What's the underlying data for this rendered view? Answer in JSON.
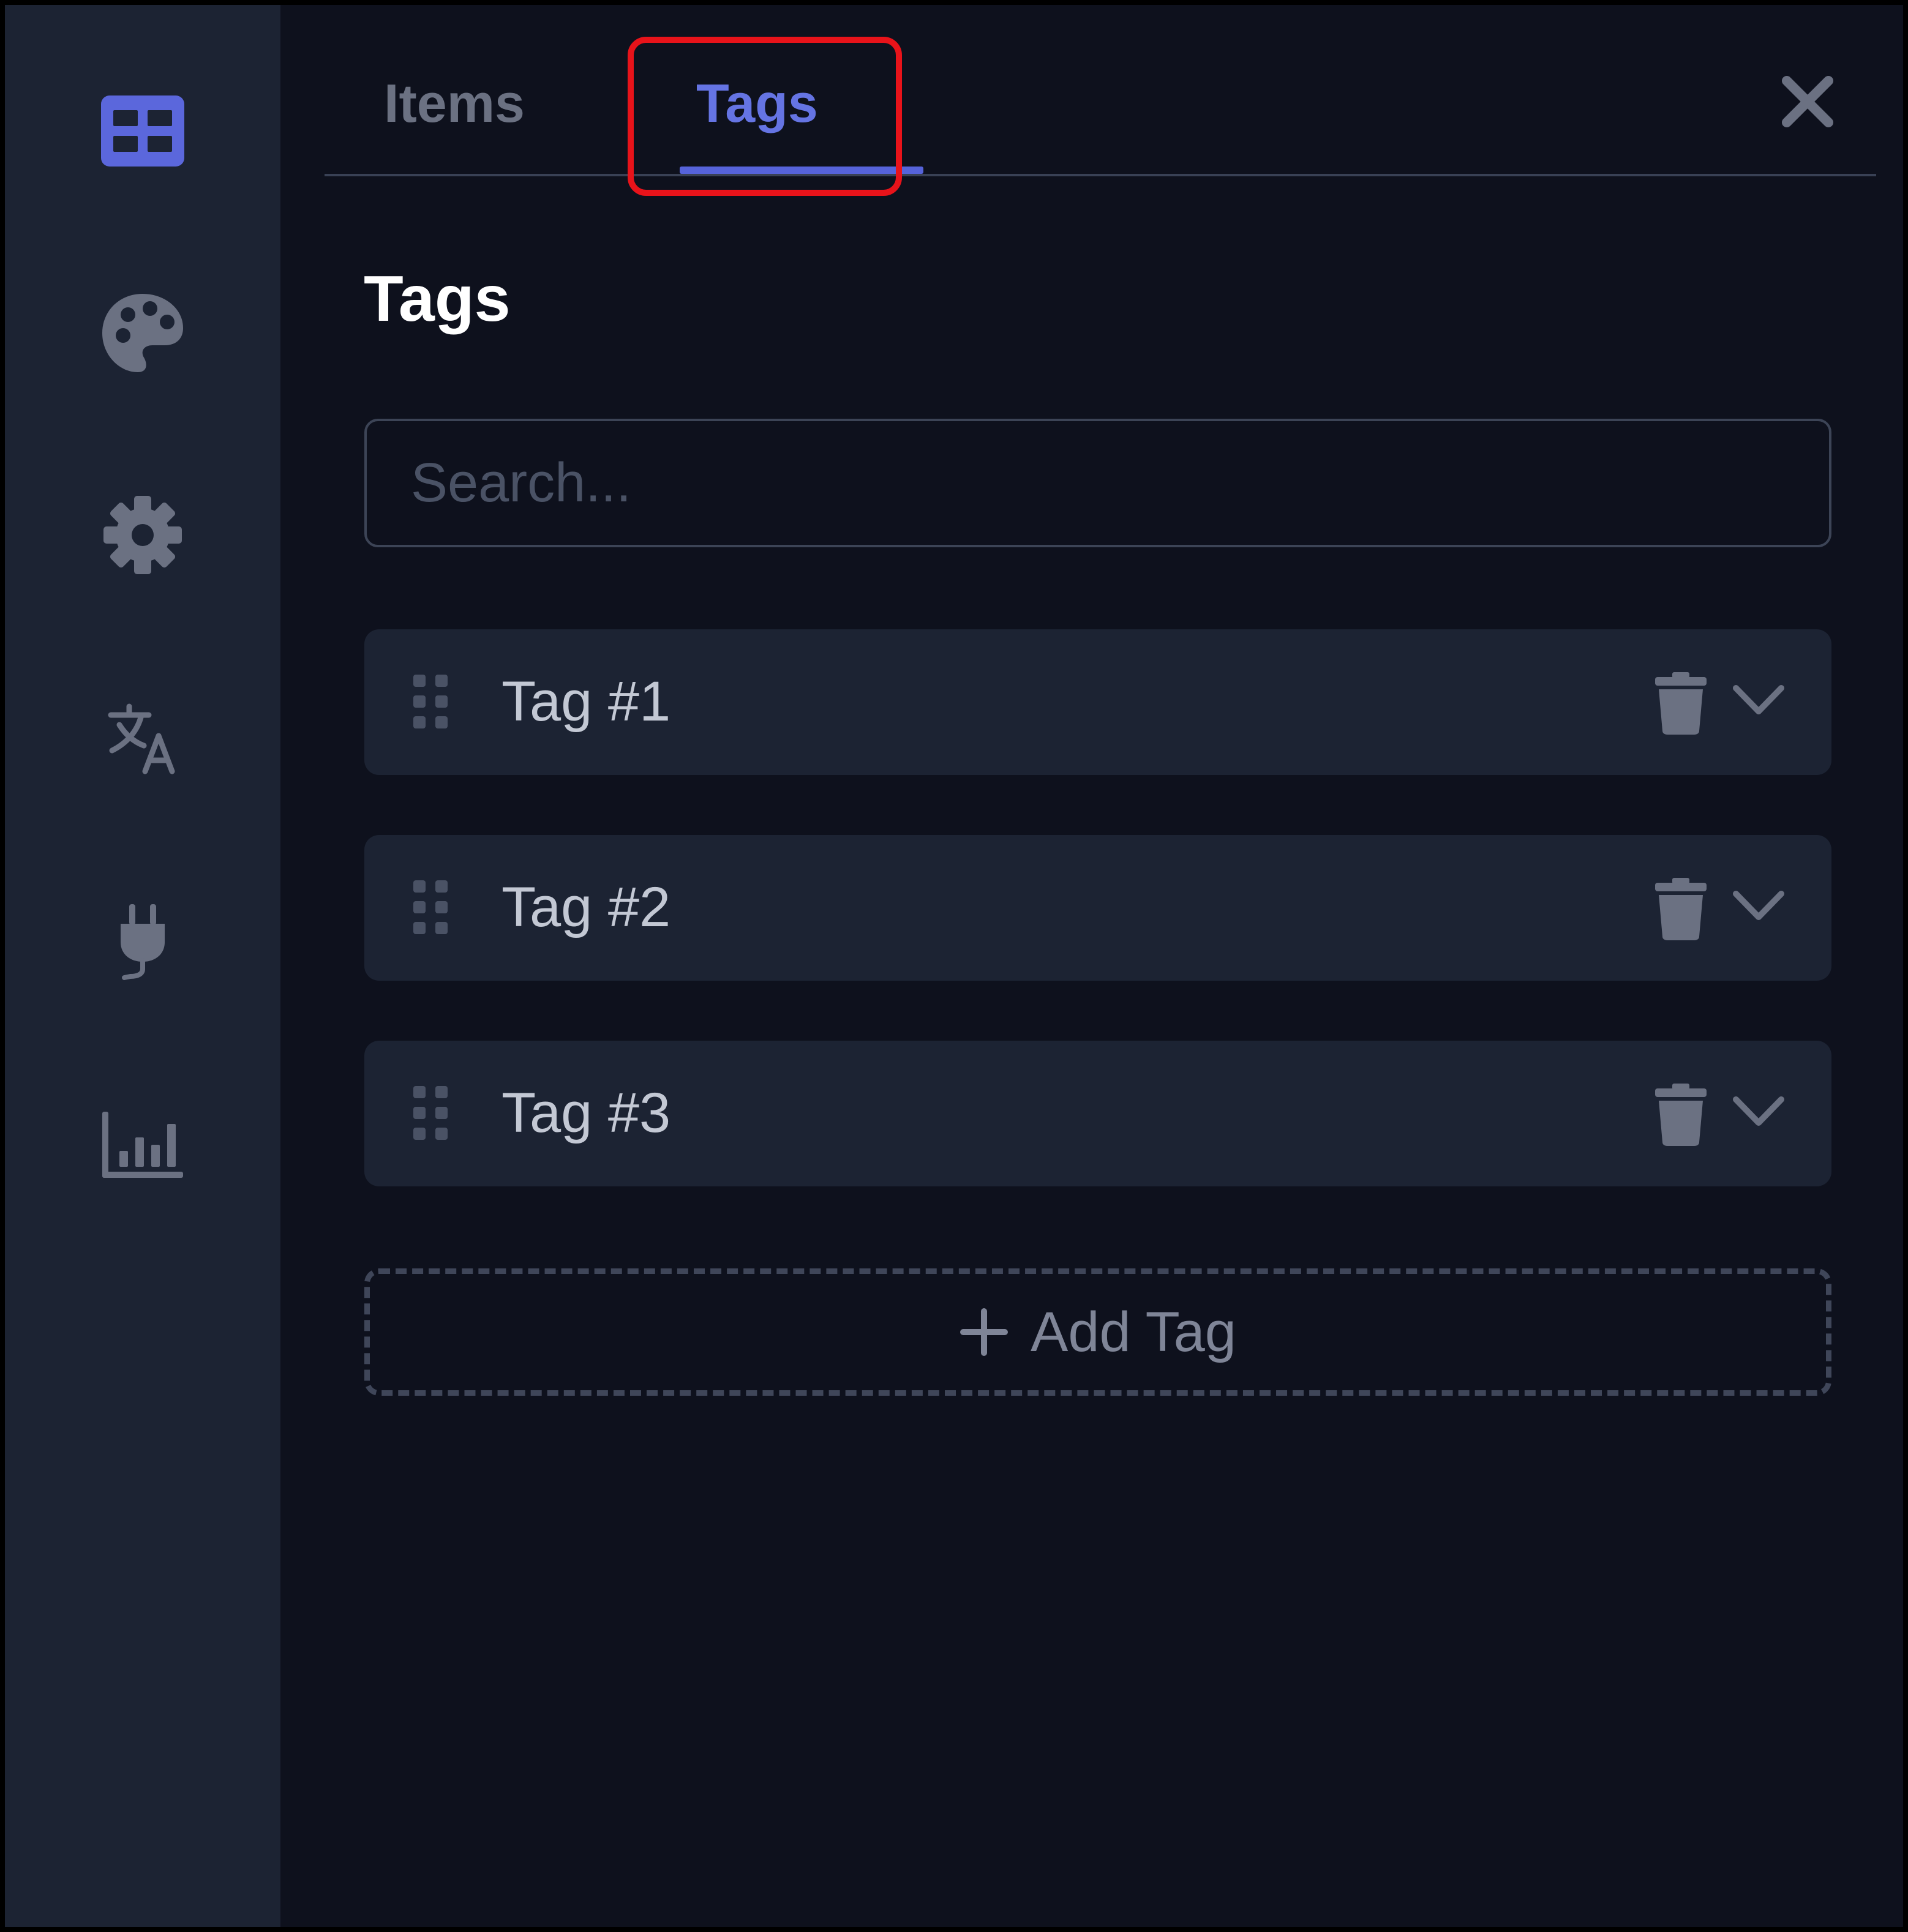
{
  "tabs": [
    {
      "label": "Items",
      "active": false
    },
    {
      "label": "Tags",
      "active": true
    }
  ],
  "section": {
    "title": "Tags"
  },
  "search": {
    "placeholder": "Search...",
    "value": ""
  },
  "tags": [
    {
      "label": "Tag #1"
    },
    {
      "label": "Tag #2"
    },
    {
      "label": "Tag #3"
    }
  ],
  "add_button": {
    "label": "Add Tag",
    "icon": "plus-icon"
  },
  "sidebar": {
    "icons": [
      "grid-icon",
      "palette-icon",
      "gear-icon",
      "translate-icon",
      "plug-icon",
      "chart-icon"
    ],
    "active_icon": "grid-icon"
  },
  "colors": {
    "accent": "#5663da",
    "highlight": "#e8131a",
    "background": "#0e111d",
    "sidebar": "#1c2333",
    "row": "#1c2333",
    "icon": "#6b7182"
  }
}
